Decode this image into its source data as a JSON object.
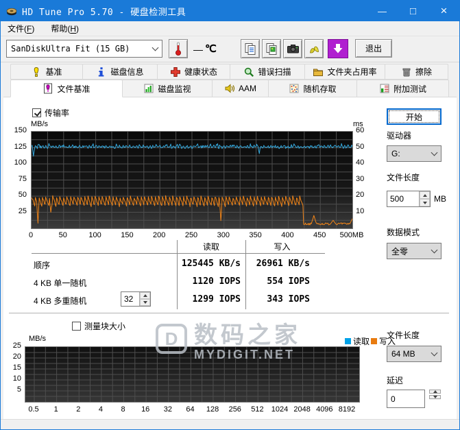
{
  "window": {
    "title": "HD Tune Pro 5.70 - 硬盘检测工具",
    "minimize": "—",
    "maximize": "□",
    "close": "×"
  },
  "menu": {
    "file": {
      "pre": "文件(",
      "key": "F",
      "post": ")"
    },
    "help": {
      "pre": "帮助(",
      "key": "H",
      "post": ")"
    }
  },
  "toolbar": {
    "device": "SanDiskUltra Fit (15 GB)",
    "temp_dash": "—",
    "temp_unit": "℃",
    "exit_label": "退出"
  },
  "tabs": {
    "row1": [
      {
        "id": "benchmark",
        "label": "基准",
        "icon": "benchmark"
      },
      {
        "id": "disk-info",
        "label": "磁盘信息",
        "icon": "info"
      },
      {
        "id": "health",
        "label": "健康状态",
        "icon": "health"
      },
      {
        "id": "error-scan",
        "label": "错误扫描",
        "icon": "scan"
      },
      {
        "id": "folder-usage",
        "label": "文件夹占用率",
        "icon": "folder"
      },
      {
        "id": "erase",
        "label": "擦除",
        "icon": "erase"
      }
    ],
    "row2": [
      {
        "id": "file-benchmark",
        "label": "文件基准",
        "icon": "filebench",
        "active": true
      },
      {
        "id": "disk-monitor",
        "label": "磁盘监视",
        "icon": "monitor",
        "active": false
      },
      {
        "id": "aam",
        "label": "AAM",
        "icon": "aam",
        "active": false
      },
      {
        "id": "random-access",
        "label": "随机存取",
        "icon": "random",
        "active": false
      },
      {
        "id": "extra-tests",
        "label": "附加测试",
        "icon": "extra",
        "active": false
      }
    ]
  },
  "transfer": {
    "label": "传输率",
    "checked": true
  },
  "block": {
    "label": "测量块大小",
    "checked": false
  },
  "results_table": {
    "col_read": "读取",
    "col_write": "写入",
    "rows": [
      {
        "label": "顺序",
        "read": "125445 KB/s",
        "write": "26961 KB/s"
      },
      {
        "label": "4 KB 单一随机",
        "read": "1120 IOPS",
        "write": "554 IOPS"
      },
      {
        "label": "4 KB 多重随机",
        "spin": "32",
        "read": "1299 IOPS",
        "write": "343 IOPS"
      }
    ]
  },
  "right_panel": {
    "start_label": "开始",
    "drive_label": "驱动器",
    "drive_value": "G:",
    "filelen_label": "文件长度",
    "filelen_value": "500",
    "filelen_unit": "MB",
    "datamode_label": "数据模式",
    "datamode_value": "全零"
  },
  "right_panel2": {
    "filelen_label": "文件长度",
    "filelen_value": "64 MB",
    "delay_label": "延迟",
    "delay_value": "0"
  },
  "watermark": {
    "logo": "D",
    "line1": "数码之家",
    "line2": "MYDIGIT.NET"
  },
  "chart_data": [
    {
      "type": "line",
      "title": "传输率",
      "ylabel_left": "MB/s",
      "ylabel_right": "ms",
      "y_left": {
        "max": 150,
        "ticks": [
          150,
          125,
          100,
          75,
          50,
          25
        ]
      },
      "y_right": {
        "max": 60,
        "ticks": [
          60,
          50,
          40,
          30,
          20,
          10
        ]
      },
      "x": {
        "max": 500,
        "tick_labels": [
          "0",
          "50",
          "100",
          "150",
          "200",
          "250",
          "300",
          "350",
          "400",
          "450",
          "500MB"
        ]
      },
      "series": [
        {
          "name": "读取",
          "color": "#35a8dc",
          "unit": "MB/s",
          "baseline": 126.5,
          "ripple": 1.4,
          "noise": 1.5,
          "spike": 2.8,
          "dips": [
            [
              3,
              112
            ],
            [
              355,
              116
            ]
          ]
        },
        {
          "name": "写入",
          "color": "#f28518",
          "unit": "MB/s",
          "high": 49.5,
          "low": 33.5,
          "period": 5.5,
          "noise": 1.4,
          "dips": [
            [
              10,
              8
            ],
            [
              30,
              25
            ],
            [
              295,
              12
            ]
          ],
          "tail_start": 424,
          "tail_base": 7,
          "tail_noise": 1.6,
          "tail_spikes": [
            [
              440,
              20
            ],
            [
              470,
              12.5
            ],
            [
              500,
              15
            ]
          ]
        }
      ]
    },
    {
      "type": "line",
      "title": "测量块大小",
      "ylabel": "MB/s",
      "y": {
        "max": 25,
        "ticks": [
          25,
          20,
          15,
          10,
          5
        ]
      },
      "x_tick_labels": [
        "0.5",
        "1",
        "2",
        "4",
        "8",
        "16",
        "32",
        "64",
        "128",
        "256",
        "512",
        "1024",
        "2048",
        "4096",
        "8192"
      ],
      "legend": [
        {
          "label": "读取",
          "color": "#00a2e8"
        },
        {
          "label": "写入",
          "color": "#e87b10"
        }
      ],
      "series": []
    }
  ]
}
